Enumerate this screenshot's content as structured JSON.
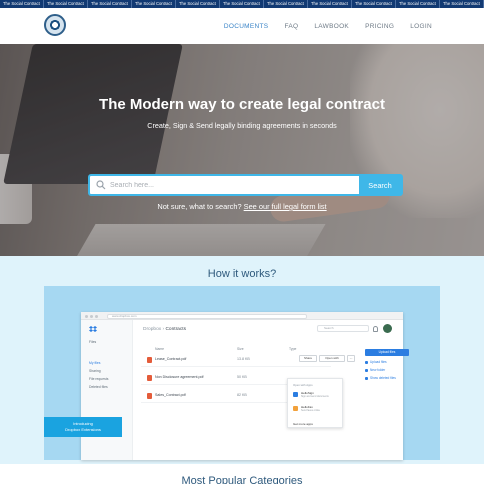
{
  "ticker": {
    "items": [
      "The Social Contract",
      "The Social Contract",
      "The Social Contract",
      "The Social Contract",
      "The Social Contract",
      "The Social Contract",
      "The Social Contract",
      "The Social Contract",
      "The Social Contract",
      "The Social Contract",
      "The Social Contract"
    ]
  },
  "nav": {
    "links": [
      "DOCUMENTS",
      "FAQ",
      "LAWBOOK",
      "PRICING",
      "LOGIN"
    ],
    "active_color": "#3a84c7"
  },
  "hero": {
    "title": "The Modern way to create legal contract",
    "subtitle": "Create, Sign & Send legally binding agreements in seconds",
    "search_placeholder": "Search here...",
    "search_button": "Search",
    "help_prefix": "Not sure, what to search?",
    "help_link": "See our full legal form list",
    "accent_color": "#3fb7e8"
  },
  "how": {
    "title": "How it works?",
    "demo": {
      "url": "www.dropbox.com",
      "sidebar": {
        "header": "Files",
        "items": [
          "My files",
          "Sharing",
          "File requests",
          "Deleted files"
        ]
      },
      "breadcrumb": {
        "parent": "Dropbox",
        "separator": "›",
        "current": "Contracts"
      },
      "search_placeholder": "Search",
      "columns": [
        "Name",
        "Size",
        "Type"
      ],
      "rows": [
        {
          "name": "Lease_Contract.pdf",
          "size": "13.8 KB"
        },
        {
          "name": "Non Disclosure agreement.pdf",
          "size": "50 KB"
        },
        {
          "name": "Sales_Contract.pdf",
          "size": "82 KB"
        }
      ],
      "share_label": "Share",
      "open_label": "Open with",
      "more_label": "...",
      "menu": {
        "header": "Open with Apps",
        "apps": [
          {
            "title": "HelloSign",
            "desc": "Sign and send documents",
            "color": "#2b7de1"
          },
          {
            "title": "HelloFax",
            "desc": "Send faxes online",
            "color": "#f2a13b"
          }
        ],
        "more": "Get more apps"
      },
      "panel": {
        "upload": "Upload files",
        "items": [
          "Upload files",
          "New folder",
          "Show deleted files"
        ]
      },
      "intro": {
        "line1": "Introducing",
        "line2": "Dropbox Extensions"
      }
    }
  },
  "popular": {
    "title": "Most Popular Categories"
  }
}
